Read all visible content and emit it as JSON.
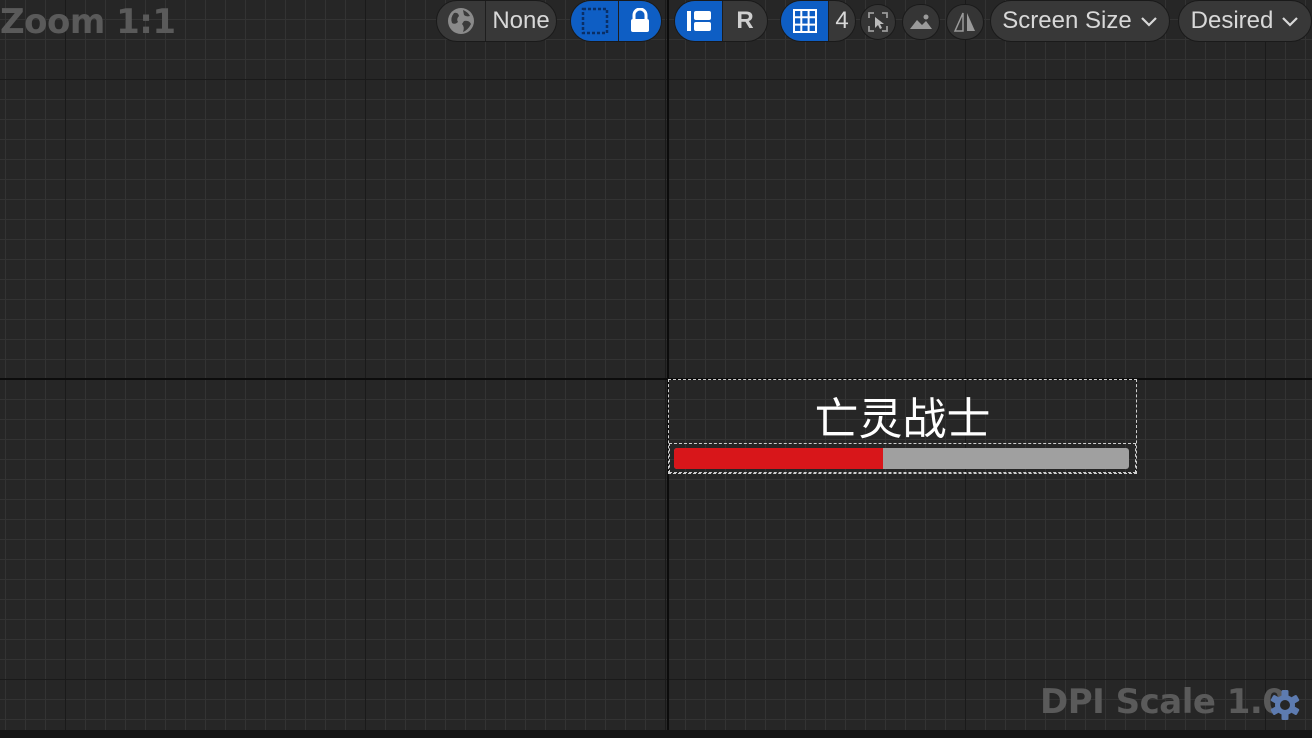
{
  "viewport": {
    "zoom_label": "Zoom 1:1",
    "dpi_label": "DPI Scale 1.0"
  },
  "toolbar": {
    "world_icon": "globe-icon",
    "world_label": "None",
    "grid_count": "4",
    "respect_locks_label": "R",
    "screen_size_label": "Screen Size",
    "fill_mode_label": "Desired"
  },
  "widget": {
    "title": "亡灵战士",
    "health_percent": 46,
    "health_color": "#d8161a",
    "track_color": "#a0a0a0"
  },
  "colors": {
    "accent": "#0e5ec4",
    "background": "#262626"
  }
}
